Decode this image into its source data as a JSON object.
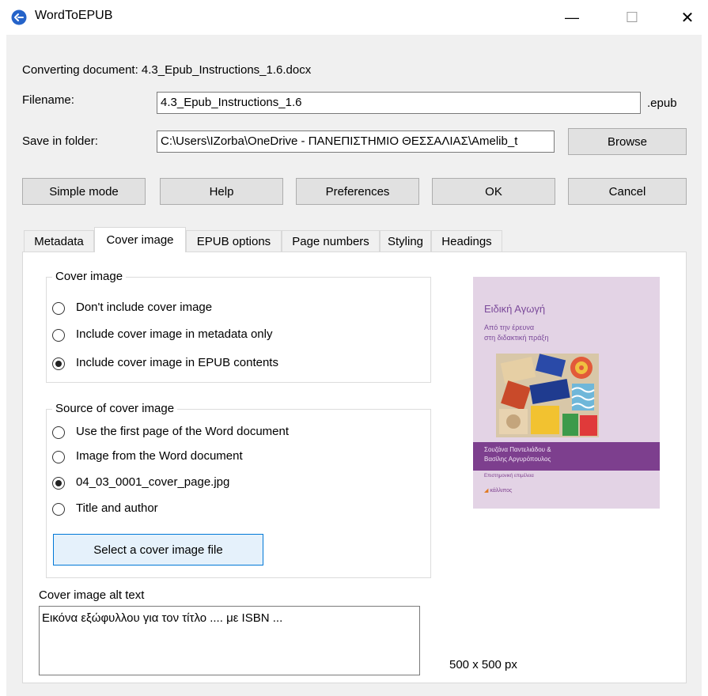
{
  "window": {
    "title": "WordToEPUB",
    "minimize_symbol": "—",
    "maximize_symbol": "☐",
    "close_symbol": "✕"
  },
  "converting": {
    "text": "Converting document: 4.3_Epub_Instructions_1.6.docx"
  },
  "filename": {
    "label": "Filename:",
    "value": "4.3_Epub_Instructions_1.6",
    "extension": ".epub"
  },
  "save_folder": {
    "label": "Save in folder:",
    "value": "C:\\Users\\IZorba\\OneDrive - ΠΑΝΕΠΙΣΤΗΜΙΟ ΘΕΣΣΑΛΙΑΣ\\Amelib_t",
    "browse_label": "Browse"
  },
  "actions": {
    "simple_mode": "Simple mode",
    "help": "Help",
    "preferences": "Preferences",
    "ok": "OK",
    "cancel": "Cancel"
  },
  "tabs": [
    {
      "label": "Metadata"
    },
    {
      "label": "Cover image"
    },
    {
      "label": "EPUB options"
    },
    {
      "label": "Page numbers"
    },
    {
      "label": "Styling"
    },
    {
      "label": "Headings"
    }
  ],
  "cover_group": {
    "title": "Cover image",
    "options": [
      {
        "label": "Don't include cover image",
        "selected": false
      },
      {
        "label": "Include cover image in metadata only",
        "selected": false
      },
      {
        "label": "Include cover image in EPUB contents",
        "selected": true
      }
    ]
  },
  "source_group": {
    "title": "Source of cover image",
    "options": [
      {
        "label": "Use the first page of the Word document",
        "selected": false
      },
      {
        "label": "Image from the Word document",
        "selected": false
      },
      {
        "label": "04_03_0001_cover_page.jpg",
        "selected": true
      },
      {
        "label": "Title and author",
        "selected": false
      }
    ],
    "select_button": "Select a cover image file"
  },
  "alt_text": {
    "label": "Cover image alt text",
    "value": "Εικόνα εξώφυλλου για τον τίτλο .... με ISBN ..."
  },
  "preview": {
    "book_title": "Ειδική Αγωγή",
    "book_subtitle_1": "Από την έρευνα",
    "book_subtitle_2": "στη διδακτική πράξη",
    "authors_1": "Σουζάνα Παντελιάδου &",
    "authors_2": "Βασίλης Αργυρόπουλος",
    "imprint": "Επιστημονική επιμέλεια",
    "publisher": "κάλλιπος",
    "size_text": "500 x 500 px",
    "colors": {
      "background": "#e3d3e5",
      "title": "#7b4a9a",
      "band": "#7d3f8e"
    }
  }
}
